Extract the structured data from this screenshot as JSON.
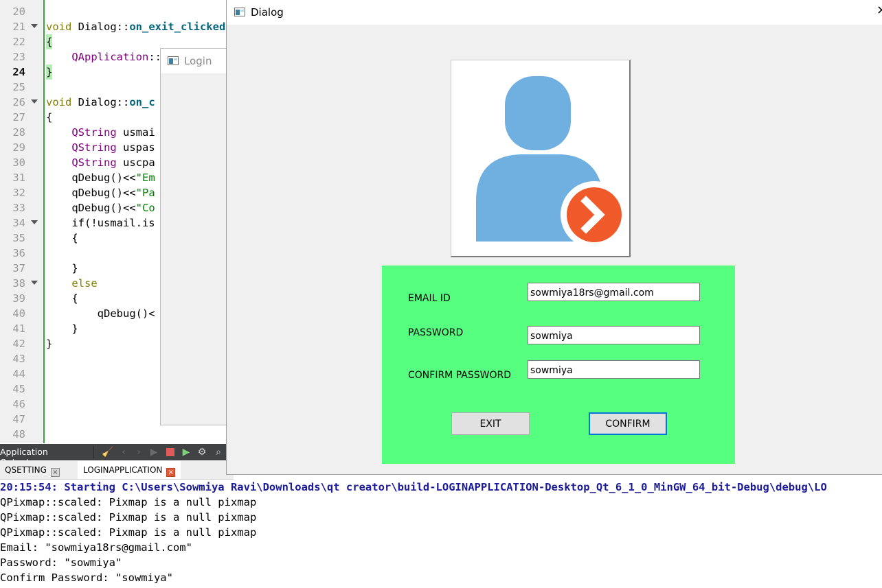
{
  "editor": {
    "lines": [
      {
        "n": "20",
        "code": ""
      },
      {
        "n": "21",
        "code": "void Dialog::on_exit_clicked()"
      },
      {
        "n": "22",
        "code": "{"
      },
      {
        "n": "23",
        "code": "    QApplication::quit();"
      },
      {
        "n": "24",
        "code": "}"
      },
      {
        "n": "25",
        "code": ""
      },
      {
        "n": "26",
        "code": "void Dialog::on_c"
      },
      {
        "n": "27",
        "code": "{"
      },
      {
        "n": "28",
        "code": "    QString usmai"
      },
      {
        "n": "29",
        "code": "    QString uspas"
      },
      {
        "n": "30",
        "code": "    QString uscpa"
      },
      {
        "n": "31",
        "code": "    qDebug()<<\"Em"
      },
      {
        "n": "32",
        "code": "    qDebug()<<\"Pa"
      },
      {
        "n": "33",
        "code": "    qDebug()<<\"Co"
      },
      {
        "n": "34",
        "code": "    if(!usmail.is"
      },
      {
        "n": "35",
        "code": "    {"
      },
      {
        "n": "36",
        "code": ""
      },
      {
        "n": "37",
        "code": "    }"
      },
      {
        "n": "38",
        "code": "    else"
      },
      {
        "n": "39",
        "code": "    {"
      },
      {
        "n": "40",
        "code": "        qDebug()<"
      },
      {
        "n": "41",
        "code": "    }"
      },
      {
        "n": "42",
        "code": "}"
      },
      {
        "n": "43",
        "code": ""
      },
      {
        "n": "44",
        "code": ""
      },
      {
        "n": "45",
        "code": ""
      },
      {
        "n": "46",
        "code": ""
      },
      {
        "n": "47",
        "code": ""
      },
      {
        "n": "48",
        "code": ""
      }
    ],
    "current_line": "24"
  },
  "login_window": {
    "title": "Login"
  },
  "output_pane": {
    "label": "Application Output",
    "tabs": [
      {
        "label": "QSETTING"
      },
      {
        "label": "LOGINAPPLICATION"
      }
    ],
    "lines": [
      "20:15:54: Starting C:\\Users\\Sowmiya Ravi\\Downloads\\qt creator\\build-LOGINAPPLICATION-Desktop_Qt_6_1_0_MinGW_64_bit-Debug\\debug\\LO",
      "QPixmap::scaled: Pixmap is a null pixmap",
      "QPixmap::scaled: Pixmap is a null pixmap",
      "QPixmap::scaled: Pixmap is a null pixmap",
      "Email: \"sowmiya18rs@gmail.com\"",
      "Password: \"sowmiya\"",
      "Confirm Password: \"sowmiya\""
    ]
  },
  "dialog": {
    "title": "Dialog",
    "form": {
      "email_label": "EMAIL ID",
      "email_value": "sowmiya18rs@gmail.com",
      "password_label": "PASSWORD",
      "password_value": "sowmiya",
      "confirm_label": "CONFIRM PASSWORD",
      "confirm_value": "sowmiya",
      "exit_label": "EXIT",
      "confirm_button_label": "CONFIRM"
    },
    "colors": {
      "panel": "#57ff80",
      "avatar": "#6fb0e0",
      "arrow_badge": "#f05a2b"
    }
  }
}
